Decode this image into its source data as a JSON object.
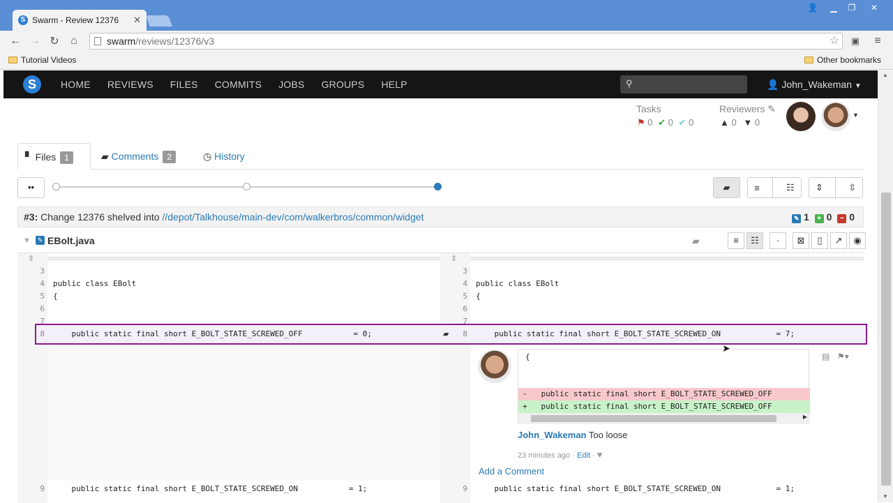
{
  "browser": {
    "tab_title": "Swarm - Review 12376",
    "url_host": "swarm",
    "url_path": "/reviews/12376/v3",
    "bookmark_1": "Tutorial Videos",
    "bookmark_other": "Other bookmarks"
  },
  "nav": {
    "items": [
      "HOME",
      "REVIEWS",
      "FILES",
      "COMMITS",
      "JOBS",
      "GROUPS",
      "HELP"
    ],
    "user": "John_Wakeman"
  },
  "review": {
    "tasks_label": "Tasks",
    "tasks": [
      "0",
      "0",
      "0"
    ],
    "reviewers_label": "Reviewers",
    "votes_up": "0",
    "votes_down": "0"
  },
  "tabs": [
    {
      "label": "Files",
      "count": "1"
    },
    {
      "label": "Comments",
      "count": "2"
    },
    {
      "label": "History"
    }
  ],
  "slider": {
    "position": 1.0
  },
  "change": {
    "prefix": "#3:",
    "text": " Change 12376 shelved into ",
    "path": "//depot/Talkhouse/main-dev/com/walkerbros/common/widget",
    "edited": "1",
    "added": "0",
    "deleted": "0"
  },
  "file": {
    "name": "EBolt.java"
  },
  "diff": {
    "left": [
      {
        "n": "3",
        "t": ""
      },
      {
        "n": "4",
        "t": "public class EBolt"
      },
      {
        "n": "5",
        "t": "{"
      },
      {
        "n": "6",
        "t": ""
      },
      {
        "n": "7",
        "t": ""
      },
      {
        "n": "8",
        "t": "    public static final short E_BOLT_STATE_SCREWED_OFF           = 0;"
      }
    ],
    "right": [
      {
        "n": "3",
        "t": ""
      },
      {
        "n": "4",
        "t": "public class EBolt"
      },
      {
        "n": "5",
        "t": "{"
      },
      {
        "n": "6",
        "t": ""
      },
      {
        "n": "7",
        "t": ""
      },
      {
        "n": "8",
        "t": "    public static final short E_BOLT_STATE_SCREWED_ON            = 7;"
      }
    ],
    "bottom_left": {
      "n": "9",
      "t": "    public static final short E_BOLT_STATE_SCREWED_ON           = 1;"
    },
    "bottom_right": {
      "n": "9",
      "t": "    public static final short E_BOLT_STATE_SCREWED_ON            = 1;"
    }
  },
  "comment": {
    "context_line": "{",
    "removed_line": "-   public static final short E_BOLT_STATE_SCREWED_OFF",
    "added_line": "+   public static final short E_BOLT_STATE_SCREWED_OFF",
    "author": "John_Wakeman",
    "text": "Too loose",
    "time": "23 minutes ago",
    "edit": "Edit",
    "add_comment": "Add a Comment"
  }
}
